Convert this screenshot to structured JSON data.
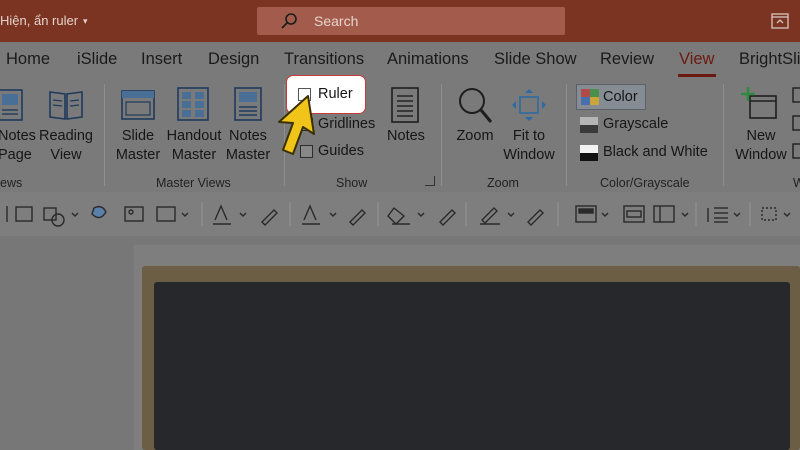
{
  "window": {
    "doc_title": "Hiện, ẩn ruler",
    "title_caret": "▾"
  },
  "search": {
    "placeholder": "Search"
  },
  "tabs": [
    "Home",
    "iSlide",
    "Insert",
    "Design",
    "Transitions",
    "Animations",
    "Slide Show",
    "Review",
    "View",
    "BrightSli"
  ],
  "active_tab": "View",
  "ribbon": {
    "presentation_views": {
      "notes_page": [
        "Notes",
        "Page"
      ],
      "reading_view": [
        "Reading",
        "View"
      ],
      "group_label": "ews"
    },
    "master_views": {
      "slide_master": [
        "Slide",
        "Master"
      ],
      "handout_master": [
        "Handout",
        "Master"
      ],
      "notes_master": [
        "Notes",
        "Master"
      ],
      "group_label": "Master Views"
    },
    "show": {
      "ruler": {
        "label": "Ruler",
        "checked": false,
        "highlighted": true
      },
      "gridlines": {
        "label": "Gridlines",
        "checked": false
      },
      "guides": {
        "label": "Guides",
        "checked": false
      },
      "notes": "Notes",
      "group_label": "Show"
    },
    "zoom": {
      "zoom": "Zoom",
      "fit_to_window": [
        "Fit to",
        "Window"
      ],
      "group_label": "Zoom"
    },
    "color_grayscale": {
      "color": "Color",
      "grayscale": "Grayscale",
      "black_and_white": "Black and White",
      "group_label": "Color/Grayscale"
    },
    "window": {
      "new_window": [
        "New",
        "Window"
      ],
      "group_label": "W"
    }
  },
  "colors": {
    "title_bar": "#7b3422",
    "accent": "#6b1a10",
    "highlight_border": "#c63b3b",
    "pointer": "#f0c419",
    "overlay_gray": "#7a7a7a"
  },
  "icons": {
    "search": "search-icon",
    "pointer": "yellow-arrow-pointer-icon",
    "restore": "ribbon-display-icon"
  }
}
